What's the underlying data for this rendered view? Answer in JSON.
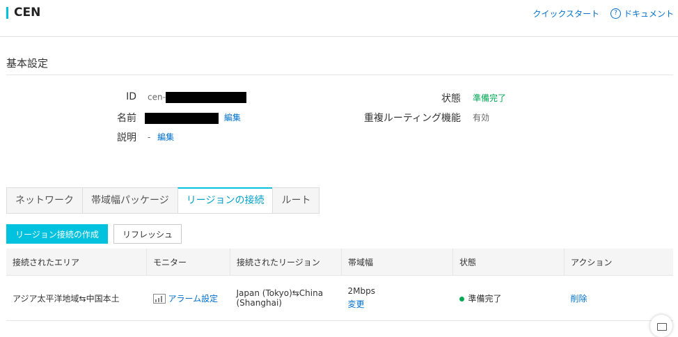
{
  "header": {
    "title": "CEN",
    "quick_start": "クイックスタート",
    "docs": "ドキュメント"
  },
  "basic": {
    "section_title": "基本設定",
    "id_label": "ID",
    "id_prefix": "cen-",
    "name_label": "名前",
    "edit": "編集",
    "desc_label": "説明",
    "desc_value": "-",
    "status_label": "状態",
    "status_value": "準備完了",
    "routing_label": "重複ルーティング機能",
    "routing_value": "有効"
  },
  "tabs": [
    "ネットワーク",
    "帯域幅パッケージ",
    "リージョンの接続",
    "ルート"
  ],
  "active_tab": 2,
  "actions": {
    "create": "リージョン接続の作成",
    "refresh": "リフレッシュ"
  },
  "table": {
    "headers": [
      "接続されたエリア",
      "モニター",
      "接続されたリージョン",
      "帯域幅",
      "状態",
      "アクション"
    ],
    "rows": [
      {
        "area": "アジア太平洋地域⇆中国本土",
        "monitor": "アラーム設定",
        "region_line1": "Japan (Tokyo)⇆China",
        "region_line2": "(Shanghai)",
        "bandwidth": "2Mbps",
        "bandwidth_action": "変更",
        "status": "準備完了",
        "action": "削除"
      }
    ]
  },
  "colors": {
    "accent": "#00c1de",
    "link": "#0070cc",
    "success": "#00a854"
  }
}
